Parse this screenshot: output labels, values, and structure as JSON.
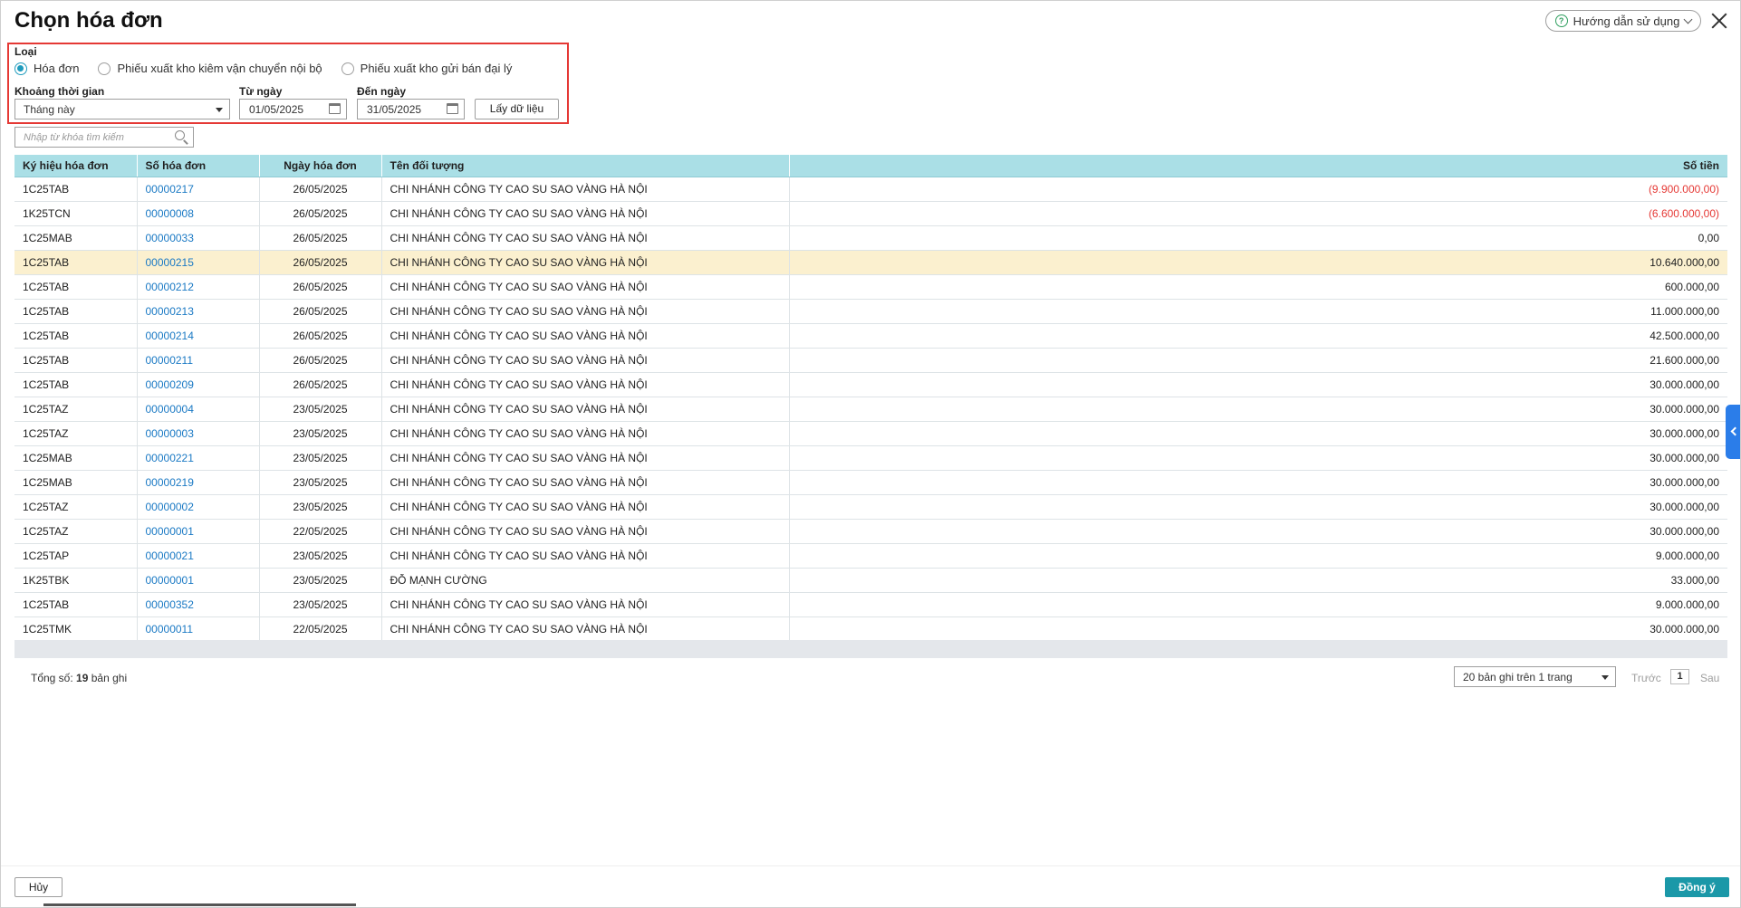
{
  "title": "Chọn hóa đơn",
  "help_label": "Hướng dẫn sử dụng",
  "filter": {
    "type_label": "Loại",
    "options": [
      "Hóa đơn",
      "Phiếu xuất kho kiêm vận chuyển nội bộ",
      "Phiếu xuất kho gửi bán đại lý"
    ],
    "selected_option": "Hóa đơn",
    "period_label": "Khoảng thời gian",
    "period_value": "Tháng này",
    "from_label": "Từ ngày",
    "from_value": "01/05/2025",
    "to_label": "Đến ngày",
    "to_value": "31/05/2025",
    "fetch_label": "Lấy dữ liệu"
  },
  "search": {
    "placeholder": "Nhập từ khóa tìm kiếm"
  },
  "table": {
    "columns": [
      "Ký hiệu hóa đơn",
      "Số hóa đơn",
      "Ngày hóa đơn",
      "Tên đối tượng",
      "Số tiền"
    ],
    "rows": [
      {
        "symbol": "1C25TAB",
        "number": "00000217",
        "date": "26/05/2025",
        "name": "CHI NHÁNH CÔNG TY CAO SU SAO VÀNG HÀ NỘI",
        "amount": "(9.900.000,00)",
        "negative": true
      },
      {
        "symbol": "1K25TCN",
        "number": "00000008",
        "date": "26/05/2025",
        "name": "CHI NHÁNH CÔNG TY CAO SU SAO VÀNG HÀ NỘI",
        "amount": "(6.600.000,00)",
        "negative": true
      },
      {
        "symbol": "1C25MAB",
        "number": "00000033",
        "date": "26/05/2025",
        "name": "CHI NHÁNH CÔNG TY CAO SU SAO VÀNG HÀ NỘI",
        "amount": "0,00"
      },
      {
        "symbol": "1C25TAB",
        "number": "00000215",
        "date": "26/05/2025",
        "name": "CHI NHÁNH CÔNG TY CAO SU SAO VÀNG HÀ NỘI",
        "amount": "10.640.000,00",
        "selected": true
      },
      {
        "symbol": "1C25TAB",
        "number": "00000212",
        "date": "26/05/2025",
        "name": "CHI NHÁNH CÔNG TY CAO SU SAO VÀNG HÀ NỘI",
        "amount": "600.000,00"
      },
      {
        "symbol": "1C25TAB",
        "number": "00000213",
        "date": "26/05/2025",
        "name": "CHI NHÁNH CÔNG TY CAO SU SAO VÀNG HÀ NỘI",
        "amount": "11.000.000,00"
      },
      {
        "symbol": "1C25TAB",
        "number": "00000214",
        "date": "26/05/2025",
        "name": "CHI NHÁNH CÔNG TY CAO SU SAO VÀNG HÀ NỘI",
        "amount": "42.500.000,00"
      },
      {
        "symbol": "1C25TAB",
        "number": "00000211",
        "date": "26/05/2025",
        "name": "CHI NHÁNH CÔNG TY CAO SU SAO VÀNG HÀ NỘI",
        "amount": "21.600.000,00"
      },
      {
        "symbol": "1C25TAB",
        "number": "00000209",
        "date": "26/05/2025",
        "name": "CHI NHÁNH CÔNG TY CAO SU SAO VÀNG HÀ NỘI",
        "amount": "30.000.000,00"
      },
      {
        "symbol": "1C25TAZ",
        "number": "00000004",
        "date": "23/05/2025",
        "name": "CHI NHÁNH CÔNG TY CAO SU SAO VÀNG HÀ NỘI",
        "amount": "30.000.000,00"
      },
      {
        "symbol": "1C25TAZ",
        "number": "00000003",
        "date": "23/05/2025",
        "name": "CHI NHÁNH CÔNG TY CAO SU SAO VÀNG HÀ NỘI",
        "amount": "30.000.000,00"
      },
      {
        "symbol": "1C25MAB",
        "number": "00000221",
        "date": "23/05/2025",
        "name": "CHI NHÁNH CÔNG TY CAO SU SAO VÀNG HÀ NỘI",
        "amount": "30.000.000,00"
      },
      {
        "symbol": "1C25MAB",
        "number": "00000219",
        "date": "23/05/2025",
        "name": "CHI NHÁNH CÔNG TY CAO SU SAO VÀNG HÀ NỘI",
        "amount": "30.000.000,00"
      },
      {
        "symbol": "1C25TAZ",
        "number": "00000002",
        "date": "23/05/2025",
        "name": "CHI NHÁNH CÔNG TY CAO SU SAO VÀNG HÀ NỘI",
        "amount": "30.000.000,00"
      },
      {
        "symbol": "1C25TAZ",
        "number": "00000001",
        "date": "22/05/2025",
        "name": "CHI NHÁNH CÔNG TY CAO SU SAO VÀNG HÀ NỘI",
        "amount": "30.000.000,00"
      },
      {
        "symbol": "1C25TAP",
        "number": "00000021",
        "date": "23/05/2025",
        "name": "CHI NHÁNH CÔNG TY CAO SU SAO VÀNG HÀ NỘI",
        "amount": "9.000.000,00"
      },
      {
        "symbol": "1K25TBK",
        "number": "00000001",
        "date": "23/05/2025",
        "name": "ĐỖ MẠNH CƯỜNG",
        "amount": "33.000,00"
      },
      {
        "symbol": "1C25TAB",
        "number": "00000352",
        "date": "23/05/2025",
        "name": "CHI NHÁNH CÔNG TY CAO SU SAO VÀNG HÀ NỘI",
        "amount": "9.000.000,00"
      },
      {
        "symbol": "1C25TMK",
        "number": "00000011",
        "date": "22/05/2025",
        "name": "CHI NHÁNH CÔNG TY CAO SU SAO VÀNG HÀ NỘI",
        "amount": "30.000.000,00"
      }
    ]
  },
  "footer": {
    "total_prefix": "Tổng số:",
    "total_count": "19",
    "total_suffix": "bản ghi",
    "page_size": "20 bản ghi trên 1 trang",
    "prev_label": "Trước",
    "page": "1",
    "next_label": "Sau"
  },
  "actions": {
    "cancel_label": "Hủy",
    "ok_label": "Đồng ý"
  },
  "colors": {
    "header_bg": "#aadfe6",
    "selected_row": "#fbf0cf",
    "link": "#1a79c4",
    "negative": "#e53935",
    "primary": "#1b98a8",
    "highlight_border": "#e53935"
  }
}
